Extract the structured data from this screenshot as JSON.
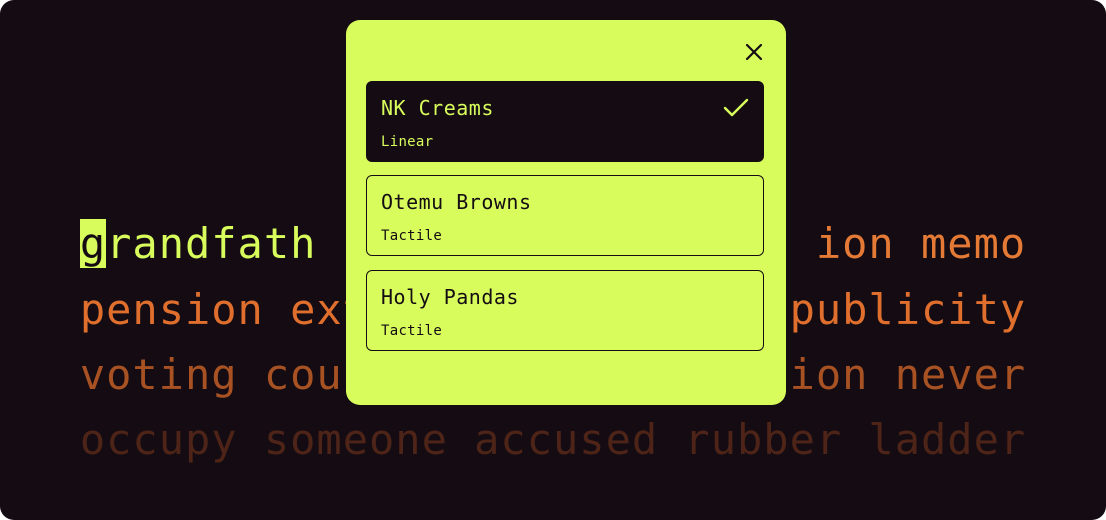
{
  "typing": {
    "line1": {
      "cursor_char": "g",
      "typed_rest": "randfath",
      "hidden_gap": "                   ",
      "visible_tail": "ion memo"
    },
    "line2": {
      "left": "pension ext",
      "hidden_gap": "                ",
      "right": "publicity"
    },
    "line3": {
      "left": "voting cou",
      "hidden_gap": "                 ",
      "right": "ion never"
    },
    "line4": "occupy someone accused rubber ladder"
  },
  "switch_modal": {
    "close_icon": "close-icon",
    "options": [
      {
        "name": "NK Creams",
        "type": "Linear",
        "selected": true
      },
      {
        "name": "Otemu Browns",
        "type": "Tactile",
        "selected": false
      },
      {
        "name": "Holy Pandas",
        "type": "Tactile",
        "selected": false
      }
    ],
    "selected_icon": "check-icon"
  },
  "colors": {
    "background": "#140c12",
    "accent": "#d7fc5c",
    "upcoming_text": "#e47a35",
    "faded_text": "#4d2417"
  }
}
